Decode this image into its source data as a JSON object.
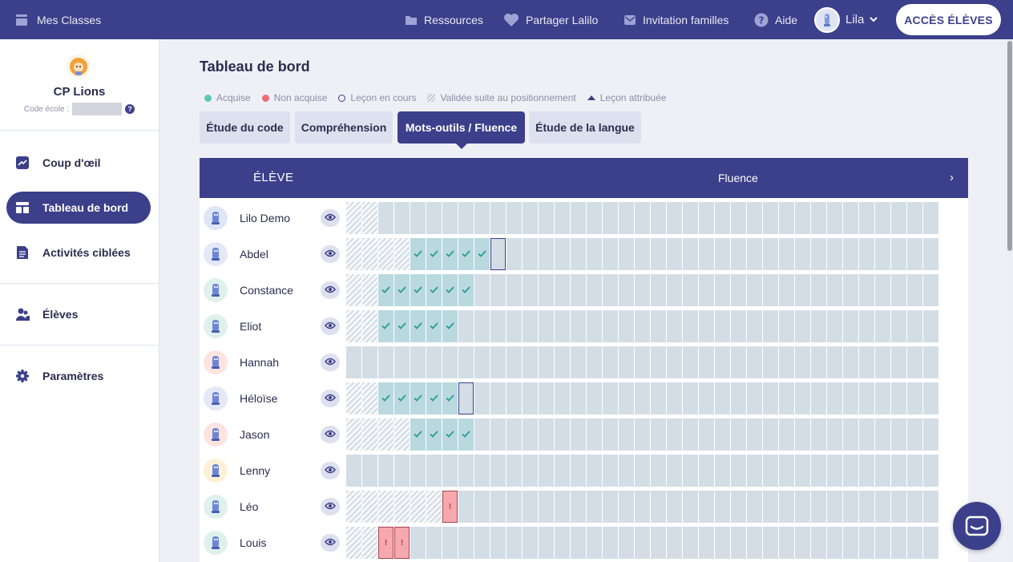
{
  "topbar": {
    "classes_label": "Mes Classes",
    "nav": [
      {
        "label": "Ressources",
        "icon": "folder-icon"
      },
      {
        "label": "Partager Lalilo",
        "icon": "heart-icon"
      },
      {
        "label": "Invitation familles",
        "icon": "mail-icon"
      },
      {
        "label": "Aide",
        "icon": "help-icon"
      }
    ],
    "user_name": "Lila",
    "access_button": "ACCÈS ÉLÈVES"
  },
  "sidebar": {
    "class_name": "CP Lions",
    "school_code_label": "Code école :",
    "items": [
      {
        "label": "Coup d'œil",
        "icon": "chart-icon"
      },
      {
        "label": "Tableau de bord",
        "icon": "dashboard-icon",
        "active": true
      },
      {
        "label": "Activités ciblées",
        "icon": "document-icon"
      },
      {
        "label": "Élèves",
        "icon": "users-icon"
      },
      {
        "label": "Paramètres",
        "icon": "gear-icon"
      }
    ]
  },
  "main": {
    "title": "Tableau de bord",
    "legend": [
      {
        "label": "Acquise",
        "color": "#5cc8b4"
      },
      {
        "label": "Non acquise",
        "color": "#ee6b78"
      },
      {
        "label": "Leçon en cours",
        "color": "#3c3f8a"
      },
      {
        "label": "Validée suite au positionnement",
        "color": "#c4c7d3"
      },
      {
        "label": "Leçon attribuée",
        "color": "#3c3f8a"
      }
    ],
    "tabs": [
      {
        "label": "Étude du code"
      },
      {
        "label": "Compréhension"
      },
      {
        "label": "Mots-outils / Fluence",
        "active": true
      },
      {
        "label": "Étude de la langue"
      }
    ],
    "table_header": {
      "student_col": "ÉLÈVE",
      "section": "Fluence",
      "next_arrow": "›"
    },
    "students": [
      {
        "name": "Lilo Demo",
        "avatar_color": "#dfe6f6",
        "cells": "hh"
      },
      {
        "name": "Abdel",
        "avatar_color": "#e4e8f7",
        "cells": "hhhhvvvvvc"
      },
      {
        "name": "Constance",
        "avatar_color": "#dff1ed",
        "cells": "hhvvvvvv"
      },
      {
        "name": "Eliot",
        "avatar_color": "#dff1ed",
        "cells": "hhvvvvv"
      },
      {
        "name": "Hannah",
        "avatar_color": "#fde4df",
        "cells": ""
      },
      {
        "name": "Héloïse",
        "avatar_color": "#e4e8f7",
        "cells": "hhvvvvvc"
      },
      {
        "name": "Jason",
        "avatar_color": "#fde4df",
        "cells": "hhhhvvvv"
      },
      {
        "name": "Lenny",
        "avatar_color": "#fdf1d8",
        "cells": ""
      },
      {
        "name": "Léo",
        "avatar_color": "#dff1ed",
        "cells": "hhhhhhx"
      },
      {
        "name": "Louis",
        "avatar_color": "#dff1ed",
        "cells": "hhxx"
      }
    ],
    "error_mark": "!"
  }
}
